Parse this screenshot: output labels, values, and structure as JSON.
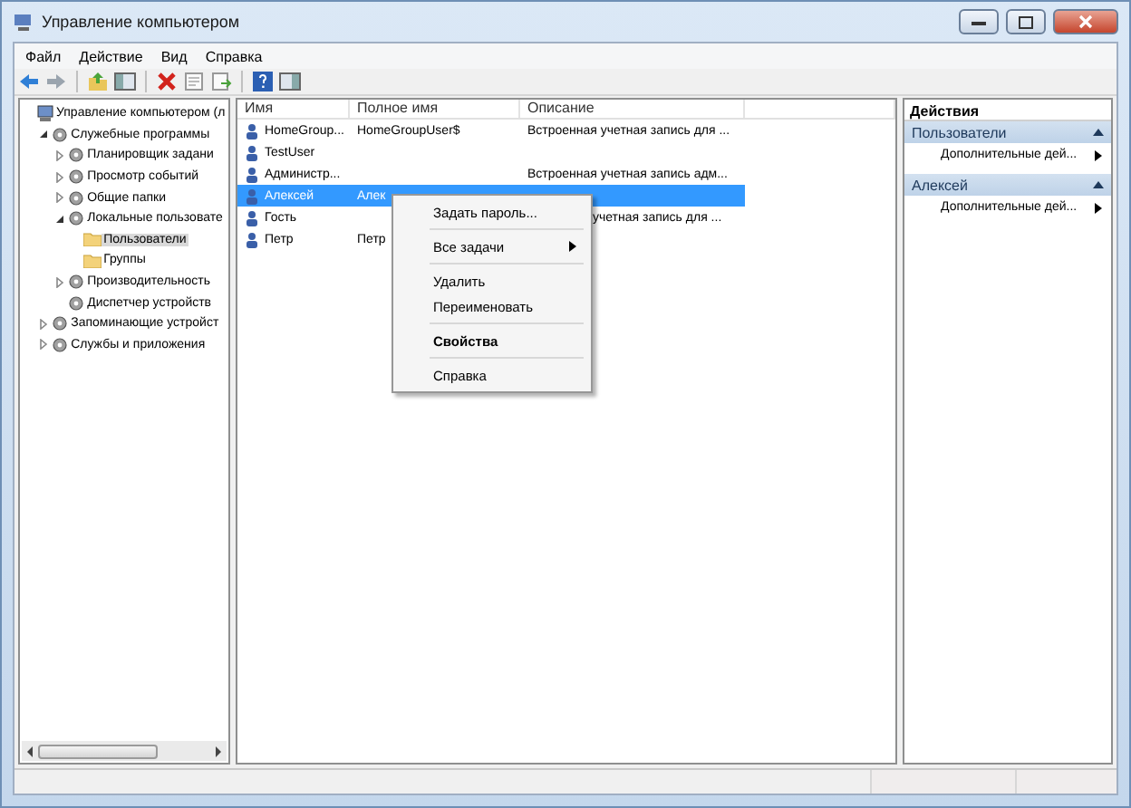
{
  "window": {
    "title": "Управление компьютером"
  },
  "menu": [
    "Файл",
    "Действие",
    "Вид",
    "Справка"
  ],
  "tree": [
    {
      "label": "Управление компьютером (л",
      "selected": false,
      "children": [
        {
          "label": "Служебные программы",
          "expanded": true,
          "selected": false,
          "children": [
            {
              "label": "Планировщик задани",
              "expanded": false,
              "selected": false
            },
            {
              "label": "Просмотр событий",
              "expanded": false,
              "selected": false
            },
            {
              "label": "Общие папки",
              "expanded": false,
              "selected": false
            },
            {
              "label": "Локальные пользовате",
              "expanded": true,
              "selected": false,
              "children": [
                {
                  "label": "Пользователи",
                  "selected": true
                },
                {
                  "label": "Группы",
                  "selected": false
                }
              ]
            },
            {
              "label": "Производительность",
              "expanded": false,
              "selected": false
            },
            {
              "label": "Диспетчер устройств",
              "selected": false
            }
          ]
        },
        {
          "label": "Запоминающие устройст",
          "expanded": false,
          "selected": false
        },
        {
          "label": "Службы и приложения",
          "expanded": false,
          "selected": false
        }
      ]
    }
  ],
  "list": {
    "columns": [
      "Имя",
      "Полное имя",
      "Описание"
    ],
    "rows": [
      {
        "name": "HomeGroup...",
        "full_name": "HomeGroupUser$",
        "description": "Встроенная учетная запись для ...",
        "selected": false
      },
      {
        "name": "TestUser",
        "full_name": "",
        "description": "",
        "selected": false
      },
      {
        "name": "Администр...",
        "full_name": "",
        "description": "Встроенная учетная запись адм...",
        "selected": false
      },
      {
        "name": "Алексей",
        "full_name": "Алек",
        "description": "",
        "selected": true
      },
      {
        "name": "Гость",
        "full_name": "",
        "description": "учетная запись для ...",
        "selected": false
      },
      {
        "name": "Петр",
        "full_name": "Петр",
        "description": "",
        "selected": false
      }
    ]
  },
  "context_menu": [
    {
      "kind": "item",
      "label": "Задать пароль...",
      "submenu": false,
      "bold": false
    },
    {
      "kind": "separator"
    },
    {
      "kind": "item",
      "label": "Все задачи",
      "submenu": true,
      "bold": false
    },
    {
      "kind": "separator"
    },
    {
      "kind": "item",
      "label": "Удалить",
      "submenu": false,
      "bold": false
    },
    {
      "kind": "item",
      "label": "Переименовать",
      "submenu": false,
      "bold": false
    },
    {
      "kind": "separator"
    },
    {
      "kind": "item",
      "label": "Свойства",
      "submenu": false,
      "bold": true
    },
    {
      "kind": "separator"
    },
    {
      "kind": "item",
      "label": "Справка",
      "submenu": false,
      "bold": false
    }
  ],
  "actions": {
    "title": "Действия",
    "sections": [
      {
        "title": "Пользователи",
        "items": [
          "Дополнительные дей..."
        ]
      },
      {
        "title": "Алексей",
        "items": [
          "Дополнительные дей..."
        ]
      }
    ]
  }
}
